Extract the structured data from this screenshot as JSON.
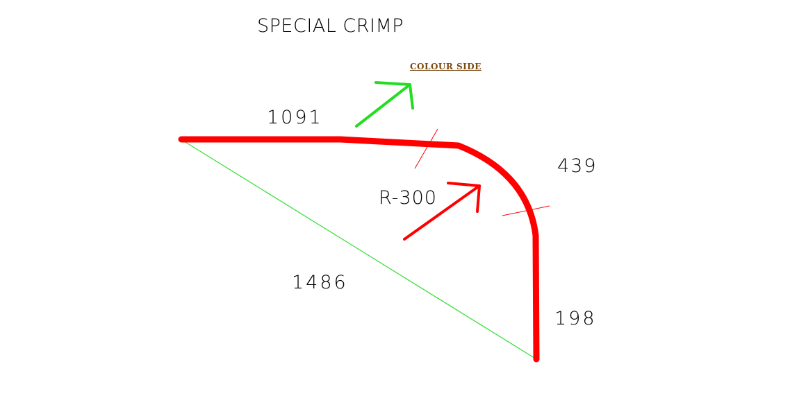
{
  "title": "SPECIAL CRIMP",
  "colour_side_label": "COLOUR SIDE",
  "dimensions": {
    "top_length": "1091",
    "bend_arc_length": "439",
    "bend_radius": "R-300",
    "diagonal_span": "1486",
    "vertical_leg": "198"
  },
  "colors": {
    "profile": "#ff0000",
    "diagonal": "#33dd33",
    "colour_side_arrow": "#22dd22",
    "radius_arrow": "#ff0000",
    "colour_side_text": "#7a4a10",
    "text": "#000000"
  }
}
